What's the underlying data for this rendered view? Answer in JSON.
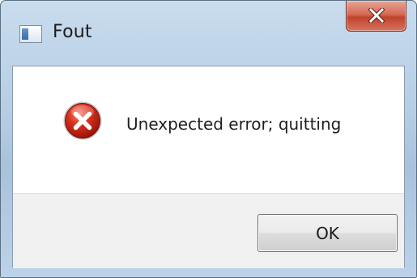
{
  "window": {
    "title": "Fout",
    "title_icon": "application-window-icon",
    "close_icon": "close-icon"
  },
  "dialog": {
    "icon": "error-icon",
    "message": "Unexpected error; quitting",
    "ok_label": "OK"
  },
  "colors": {
    "titlebar": "#b6cde4",
    "close_button": "#c0432d",
    "error_icon": "#c62828",
    "button_area": "#f0f0f0"
  }
}
